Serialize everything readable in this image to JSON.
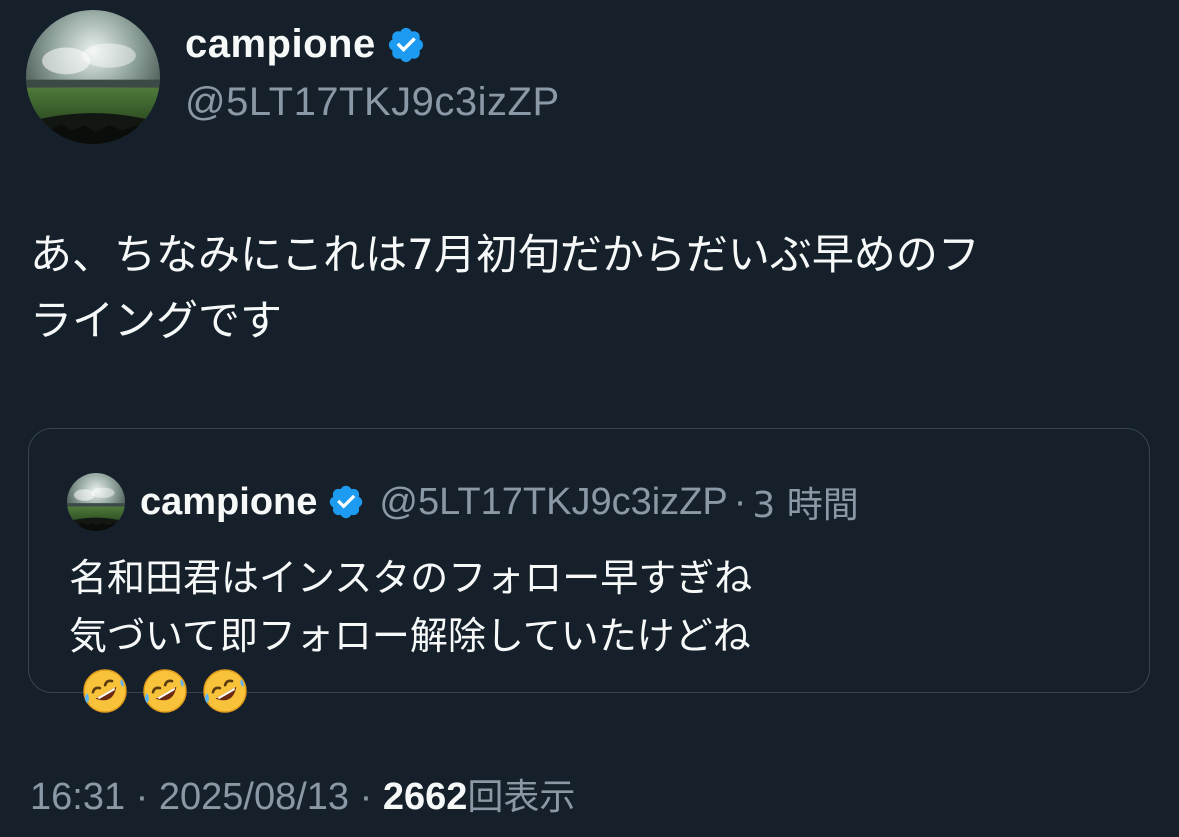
{
  "author": {
    "display_name": "campione",
    "handle": "@5LT17TKJ9c3izZP",
    "verified": true
  },
  "tweet": {
    "lines": [
      "あ、ちなみにこれは7月初旬だからだいぶ早めのフ",
      "ライングです"
    ]
  },
  "quote": {
    "display_name": "campione",
    "handle": "@5LT17TKJ9c3izZP",
    "separator": "·",
    "time": "3 時間",
    "lines": [
      "名和田君はインスタのフォロー早すぎね",
      "気づいて即フォロー解除していたけどね"
    ],
    "emoji": [
      "rolling-on-the-floor-laughing",
      "rolling-on-the-floor-laughing",
      "rolling-on-the-floor-laughing"
    ]
  },
  "meta": {
    "time": "16:31",
    "sep1": " · ",
    "date": "2025/08/13",
    "sep2": " · ",
    "views_count": "2662",
    "views_label": "回表示"
  },
  "colors": {
    "background": "#15202b",
    "text": "#f7f9f9",
    "muted": "#8b98a5",
    "border": "#38444d",
    "verified": "#1d9bf0"
  }
}
